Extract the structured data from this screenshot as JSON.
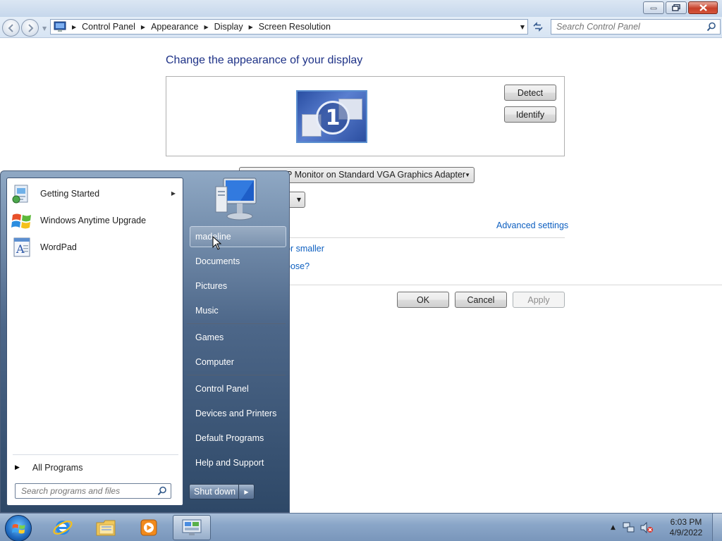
{
  "window": {
    "caption_buttons": [
      "minimize",
      "restore",
      "close"
    ]
  },
  "navbar": {
    "breadcrumbs": [
      "Control Panel",
      "Appearance",
      "Display",
      "Screen Resolution"
    ],
    "search_placeholder": "Search Control Panel"
  },
  "main": {
    "heading": "Change the appearance of your display",
    "monitor_number": "1",
    "detect_label": "Detect",
    "identify_label": "Identify",
    "display_select_value": "P Monitor on Standard VGA Graphics Adapter",
    "advanced_link": "Advanced settings",
    "link_text_size": "or smaller",
    "link_choose": "oose?",
    "ok_label": "OK",
    "cancel_label": "Cancel",
    "apply_label": "Apply"
  },
  "start_menu": {
    "pinned": [
      {
        "label": "Getting Started",
        "icon": "getting-started-icon",
        "has_submenu": true
      },
      {
        "label": "Windows Anytime Upgrade",
        "icon": "windows-flag-icon",
        "has_submenu": false
      },
      {
        "label": "WordPad",
        "icon": "wordpad-icon",
        "has_submenu": false
      }
    ],
    "all_programs_label": "All Programs",
    "search_placeholder": "Search programs and files",
    "right_items": [
      "madeline",
      "Documents",
      "Pictures",
      "Music",
      "Games",
      "Computer",
      "Control Panel",
      "Devices and Printers",
      "Default Programs",
      "Help and Support"
    ],
    "shutdown_label": "Shut down"
  },
  "taskbar": {
    "pinned": [
      "internet-explorer-icon",
      "windows-explorer-icon",
      "media-player-icon",
      "control-panel-icon"
    ],
    "active": "control-panel-icon",
    "time": "6:03 PM",
    "date": "4/9/2022"
  },
  "colors": {
    "heading": "#1e3287",
    "link": "#0d5fc0",
    "taskbar": "#8aa6c8",
    "start_menu_right": "#4d6789"
  }
}
